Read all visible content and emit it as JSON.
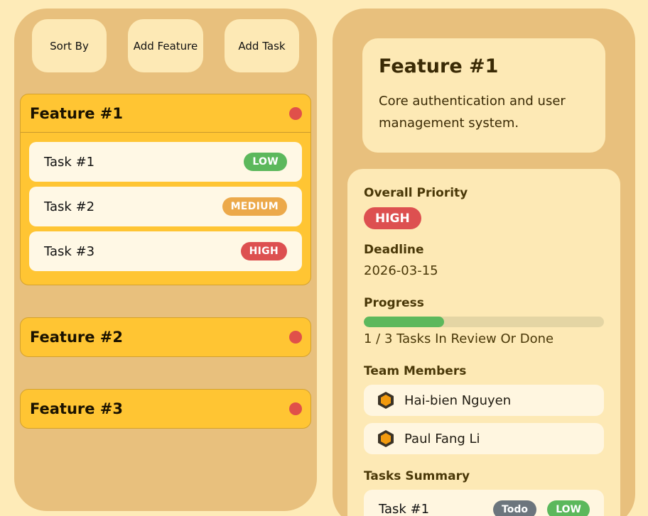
{
  "toolbar": {
    "sort_label": "Sort By",
    "add_feature_label": "Add Feature",
    "add_task_label": "Add Task"
  },
  "features": [
    {
      "title": "Feature #1",
      "status_color": "#e0504a",
      "tasks": [
        {
          "label": "Task #1",
          "priority": "LOW"
        },
        {
          "label": "Task #2",
          "priority": "MEDIUM"
        },
        {
          "label": "Task #3",
          "priority": "HIGH"
        }
      ]
    },
    {
      "title": "Feature #2",
      "status_color": "#e0504a"
    },
    {
      "title": "Feature #3",
      "status_color": "#e0504a"
    }
  ],
  "detail": {
    "title": "Feature #1",
    "description": "Core authentication and user management system.",
    "priority_label": "Overall Priority",
    "priority": "HIGH",
    "deadline_label": "Deadline",
    "deadline": "2026-03-15",
    "progress_label": "Progress",
    "progress_fraction": 0.3333,
    "progress_text": "1 / 3 Tasks In Review Or Done",
    "team_label": "Team Members",
    "members": [
      {
        "name": "Hai-bien Nguyen",
        "icon": "hexagon-avatar-icon"
      },
      {
        "name": "Paul Fang Li",
        "icon": "hexagon-avatar-icon"
      }
    ],
    "summary_label": "Tasks Summary",
    "summary_tasks": [
      {
        "label": "Task #1",
        "status": "Todo",
        "priority": "LOW"
      }
    ]
  },
  "colors": {
    "background": "#feebb8",
    "panel": "#e8c07d",
    "feature": "#ffc533",
    "low": "#5cb85c",
    "medium": "#eca94a",
    "high": "#dd5050",
    "todo": "#6c757d"
  }
}
